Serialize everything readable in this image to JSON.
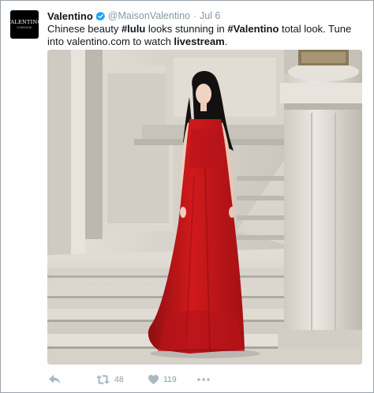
{
  "tweet": {
    "author_name": "Valentino",
    "handle": "@MaisonValentino",
    "separator": "·",
    "time": "Jul 6",
    "avatar_text": "VALENTINO",
    "avatar_subtext": "GARAVANI",
    "text_part1": "Chinese beauty ",
    "hashtag1": "#lulu",
    "text_part2": " looks stunning in ",
    "hashtag2": "#Valentino",
    "text_part3": " total look. Tune into valentino.com to watch ",
    "bold_word": "livestream",
    "text_end": "."
  },
  "actions": {
    "retweet_count": "48",
    "like_count": "119"
  },
  "icons": {
    "verified": "verified-badge-icon",
    "reply": "reply-icon",
    "retweet": "retweet-icon",
    "like": "heart-icon",
    "more": "more-dots-icon"
  },
  "colors": {
    "verified_blue": "#1da1f2",
    "muted_gray": "#8899a6",
    "icon_gray": "#aab8c2",
    "dress_red": "#c0171b"
  }
}
